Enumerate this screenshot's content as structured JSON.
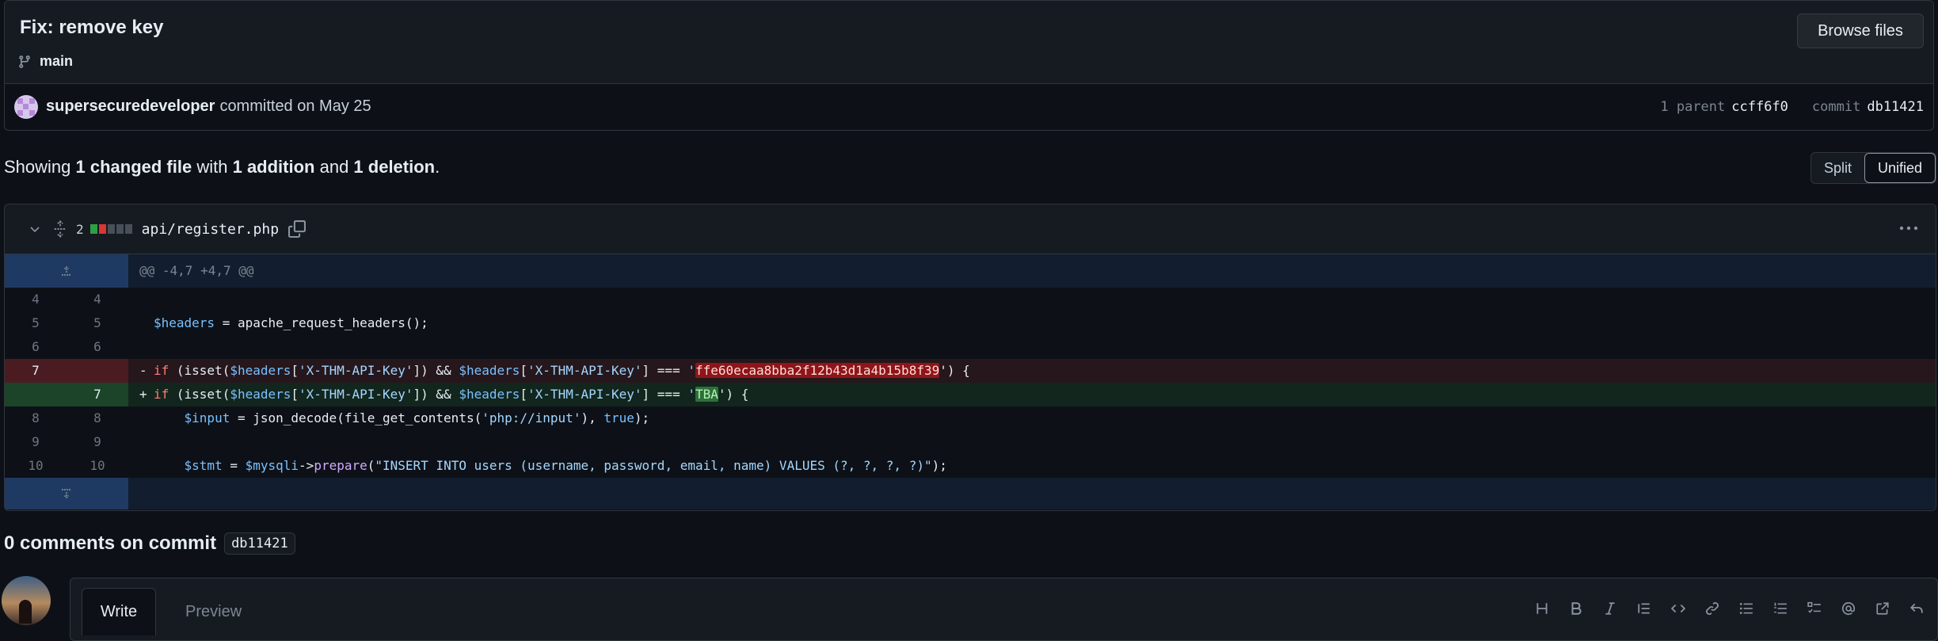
{
  "commit": {
    "title": "Fix: remove key",
    "branch": "main",
    "browse_label": "Browse files",
    "author": "supersecuredeveloper",
    "committed_text": "committed on May 25",
    "parent_label": "1 parent",
    "parent_sha": "ccff6f0",
    "commit_label": "commit",
    "commit_sha": "db11421"
  },
  "summary": {
    "prefix": "Showing ",
    "files": "1 changed file",
    "mid1": " with ",
    "additions": "1 addition",
    "mid2": " and ",
    "deletions": "1 deletion",
    "suffix": "."
  },
  "view_toggle": {
    "split": "Split",
    "unified": "Unified",
    "selected": "Unified"
  },
  "file": {
    "change_count": "2",
    "name": "api/register.php",
    "hunk_header": "@@ -4,7 +4,7 @@",
    "lines": [
      {
        "old": "4",
        "new": "4",
        "type": "context"
      },
      {
        "old": "5",
        "new": "5",
        "type": "context"
      },
      {
        "old": "6",
        "new": "6",
        "type": "context"
      },
      {
        "old": "7",
        "new": "",
        "type": "deletion"
      },
      {
        "old": "",
        "new": "7",
        "type": "addition"
      },
      {
        "old": "8",
        "new": "8",
        "type": "context"
      },
      {
        "old": "9",
        "new": "9",
        "type": "context"
      },
      {
        "old": "10",
        "new": "10",
        "type": "context"
      }
    ],
    "code": {
      "l5_var": "$headers",
      "l5_rest": " = apache_request_headers();",
      "del_marker": "-",
      "add_marker": "+",
      "if_kw": "if",
      "isset_open": " (isset(",
      "headers_var": "$headers",
      "open_bracket": "[",
      "key_str": "'X-THM-API-Key'",
      "close_and": "]) && ",
      "close_eq": "] === ",
      "q_open": "'",
      "old_key": "ffe60ecaa8bba2f12b43d1a4b15b8f39",
      "new_key": "TBA",
      "tail": "') {",
      "input_var": "$input",
      "input_rest1": " = json_decode(file_get_contents(",
      "input_str": "'php://input'",
      "input_rest2": "), ",
      "true_kw": "true",
      "input_end": ");",
      "stmt_var": "$stmt",
      "stmt_eq": " = ",
      "mysqli_var": "$mysqli",
      "arrow": "->",
      "prepare_fn": "prepare",
      "paren": "(",
      "sql_str": "\"INSERT INTO users (username, password, email, name) VALUES (?, ?, ?, ?)\"",
      "stmt_end": ");"
    }
  },
  "comments": {
    "title": "0 comments on commit",
    "sha": "db11421",
    "write_tab": "Write",
    "preview_tab": "Preview",
    "toolbar_icons": [
      "heading-icon",
      "bold-icon",
      "italic-icon",
      "quote-icon",
      "code-icon",
      "link-icon",
      "unordered-list-icon",
      "ordered-list-icon",
      "task-list-icon",
      "mention-icon",
      "cross-reference-icon",
      "reply-icon"
    ]
  },
  "colors": {
    "background": "#0d1117",
    "panel": "#161b22",
    "deletion_bg": "#25171c",
    "addition_bg": "#12261e",
    "hunk_bg": "#121d2f"
  }
}
